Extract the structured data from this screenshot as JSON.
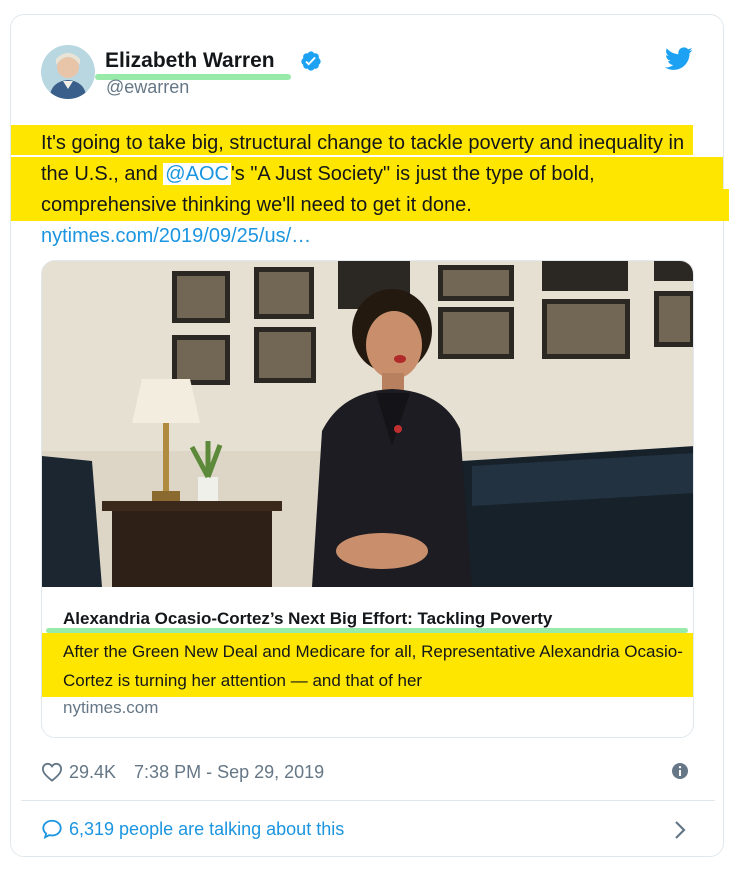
{
  "colors": {
    "twitter_blue": "#1b95e0",
    "highlight_yellow": "#ffe600",
    "underline_green": "#86e69a",
    "secondary_text": "#657786"
  },
  "author": {
    "name": "Elizabeth Warren",
    "handle": "@ewarren",
    "verified_icon": "verified-badge-icon",
    "brand_icon": "twitter-bird-icon"
  },
  "tweet": {
    "text_part1": "It's going to take big, structural change to tackle poverty and inequality in the U.S., and ",
    "mention": "@AOC",
    "text_part2": "'s \"A Just Society\" is just the type of bold, comprehensive thinking we'll need to get it done.",
    "link": "nytimes.com/2019/09/25/us/…"
  },
  "card": {
    "headline": "Alexandria Ocasio-Cortez’s Next Big Effort: Tackling Poverty",
    "description": "After the Green New Deal and Medicare for all, Representative Alexandria Ocasio-Cortez is turning her attention — and that of her",
    "domain": "nytimes.com"
  },
  "meta": {
    "likes": "29.4K",
    "timestamp": "7:38 PM - Sep 29, 2019",
    "info_icon": "info-icon"
  },
  "footer": {
    "talking": "6,319 people are talking about this"
  }
}
